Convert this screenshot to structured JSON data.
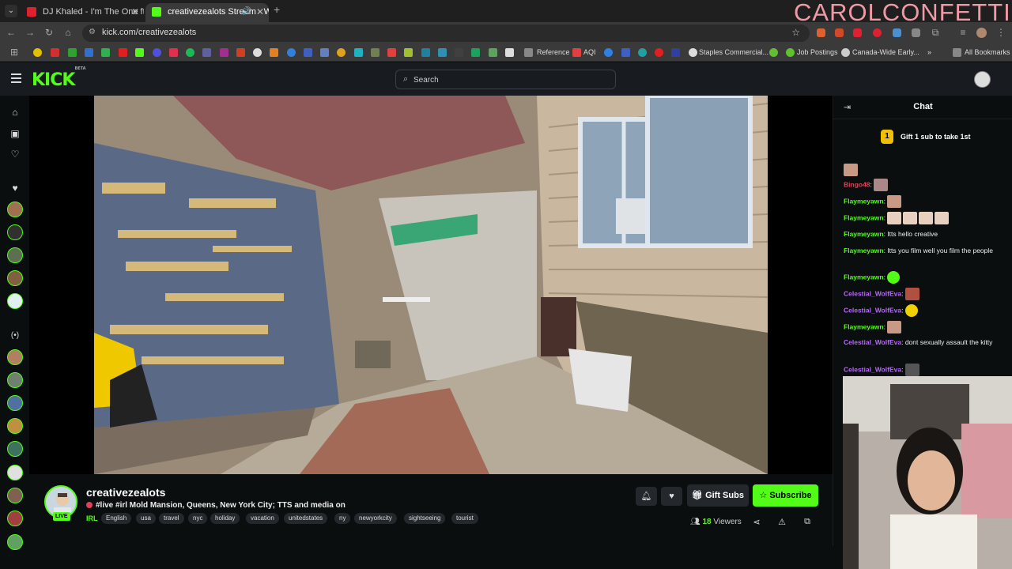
{
  "browser": {
    "tabs": [
      {
        "title": "DJ Khaled - I'm The One ft. Justin",
        "fav": "#e0202e"
      },
      {
        "title": "creativezealots Stream - Watch",
        "fav": "#53fc18"
      }
    ],
    "overlay_name": "CAROLCONFETTI",
    "url": "kick.com/creativezealots",
    "bookmarks": {
      "reference": "Reference",
      "aqi": "AQI",
      "staples": "Staples Commercial...",
      "job": "Job Postings",
      "canada": "Canada-Wide Early...",
      "all": "All Bookmarks"
    }
  },
  "kick": {
    "logo": "KICK",
    "logo_sup": "BETA",
    "search_placeholder": "Search"
  },
  "stream": {
    "streamer": "creativezealots",
    "live": "LIVE",
    "title": "#live #irl Mold Mansion, Queens, New York City; TTS and media on",
    "category": "IRL",
    "tags": [
      "English",
      "usa",
      "travel",
      "nyc",
      "holiday",
      "vacation",
      "unitedstates",
      "ny",
      "newyorkcity",
      "sightseeing",
      "tourist"
    ],
    "gift_label": "Gift Subs",
    "subscribe_label": "Subscribe",
    "viewers_count": "18",
    "viewers_label": "Viewers"
  },
  "chat": {
    "title": "Chat",
    "pinned_rank": "1",
    "pinned_text": "Gift 1 sub to take 1st",
    "messages": [
      {
        "user": "Bingo48",
        "text": ""
      },
      {
        "user": "Flaymeyawn",
        "text": ""
      },
      {
        "user": "Flaymeyawn",
        "text": ""
      },
      {
        "user": "Flaymeyawn",
        "text": "Itts hello creative"
      },
      {
        "user": "Flaymeyawn",
        "text": "Itts you film well you film the people"
      },
      {
        "user": "Flaymeyawn",
        "text": ""
      },
      {
        "user": "Celestial_WolfEva",
        "text": ""
      },
      {
        "user": "Celestial_WolfEva",
        "text": ""
      },
      {
        "user": "Flaymeyawn",
        "text": ""
      },
      {
        "user": "Celestial_WolfEva",
        "text": "dont sexually assault the kitty"
      },
      {
        "user": "Celestial_WolfEva",
        "text": ""
      }
    ]
  },
  "colors": {
    "brand": "#53fc18",
    "bg": "#0b0e0f"
  }
}
